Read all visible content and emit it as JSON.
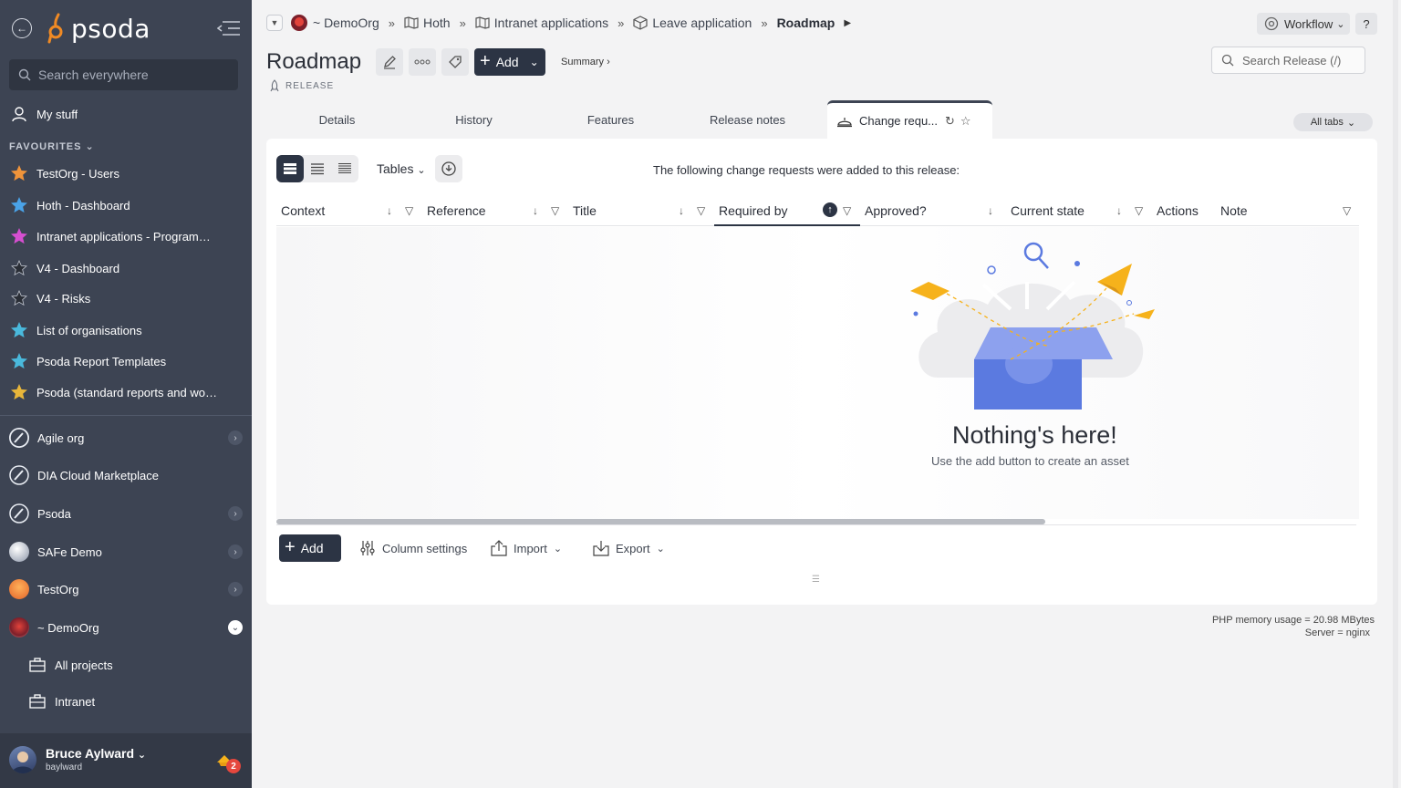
{
  "sidebar": {
    "logo_text": "psoda",
    "search_placeholder": "Search everywhere",
    "my_stuff": "My stuff",
    "favourites_heading": "FAVOURITES",
    "favourites": [
      {
        "label": "TestOrg - Users",
        "color": "#f0943a"
      },
      {
        "label": "Hoth - Dashboard",
        "color": "#4aa3e8"
      },
      {
        "label": "Intranet applications - Programme...",
        "color": "#d64fd0"
      },
      {
        "label": "V4 - Dashboard",
        "color": "#2a2e36"
      },
      {
        "label": "V4 - Risks",
        "color": "#2a2e36"
      },
      {
        "label": "List of organisations",
        "color": "#4ab9dc"
      },
      {
        "label": "Psoda Report Templates",
        "color": "#4ab9dc"
      },
      {
        "label": "Psoda (standard reports and work...",
        "color": "#e8b63a"
      }
    ],
    "orgs": [
      {
        "label": "Agile org"
      },
      {
        "label": "DIA Cloud Marketplace"
      },
      {
        "label": "Psoda"
      },
      {
        "label": "SAFe Demo"
      },
      {
        "label": "TestOrg"
      },
      {
        "label": "~ DemoOrg"
      }
    ],
    "sub_items": [
      {
        "label": "All projects"
      },
      {
        "label": "Intranet"
      }
    ],
    "user": {
      "name": "Bruce Aylward",
      "login": "baylward",
      "notifications": "2"
    }
  },
  "breadcrumb": {
    "items": [
      "~ DemoOrg",
      "Hoth",
      "Intranet applications",
      "Leave application"
    ],
    "current": "Roadmap",
    "separator": "»"
  },
  "header": {
    "workflow_label": "Workflow",
    "help_label": "?",
    "title": "Roadmap",
    "subtitle": "RELEASE",
    "add_label": "Add",
    "summary_label": "Summary ›",
    "search_placeholder": "Search Release (/)"
  },
  "tabs": {
    "items": [
      "Details",
      "History",
      "Features",
      "Release notes"
    ],
    "active": "Change requ...",
    "all_tabs": "All tabs"
  },
  "panel": {
    "tables_label": "Tables",
    "description": "The following change requests were added to this release:",
    "columns": [
      "Context",
      "Reference",
      "Title",
      "Required by",
      "Approved?",
      "Current state",
      "Actions",
      "Note"
    ],
    "empty_title": "Nothing's here!",
    "empty_sub": "Use the add button to create an asset",
    "add_label": "Add",
    "column_settings": "Column settings",
    "import_label": "Import",
    "export_label": "Export"
  },
  "footer": {
    "memory": "PHP memory usage = 20.98 MBytes",
    "server": "Server = nginx"
  },
  "colors": {
    "sidebar_bg": "#3d4453",
    "accent_dark": "#2c3444",
    "illustration_blue": "#5b7ae0",
    "illustration_yellow": "#f6b21b"
  }
}
